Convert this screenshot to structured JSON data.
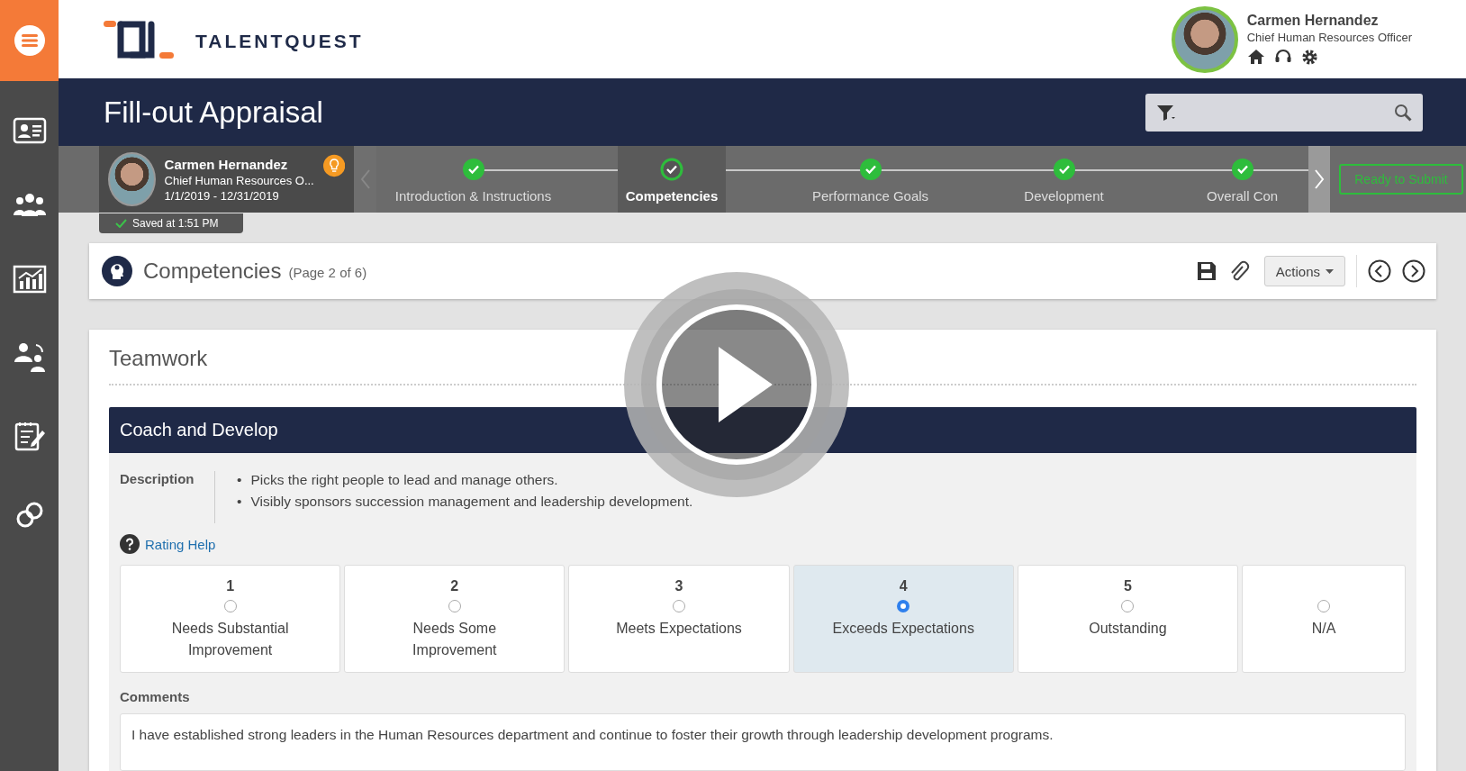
{
  "logo": {
    "text": "TALENTQUEST"
  },
  "user": {
    "name": "Carmen Hernandez",
    "role": "Chief Human Resources Officer"
  },
  "title": "Fill-out Appraisal",
  "employee": {
    "name": "Carmen Hernandez",
    "role": "Chief Human Resources O...",
    "period": "1/1/2019 - 12/31/2019",
    "saved": "Saved at 1:51 PM"
  },
  "steps": [
    {
      "label": "Introduction & Instructions",
      "done": true,
      "selected": false
    },
    {
      "label": "Competencies",
      "done": true,
      "selected": true
    },
    {
      "label": "Performance Goals",
      "done": true,
      "selected": false
    },
    {
      "label": "Development",
      "done": true,
      "selected": false
    },
    {
      "label": "Overall Con",
      "done": true,
      "selected": false
    }
  ],
  "submit_button": "Ready to Submit",
  "section": {
    "title": "Competencies",
    "page": "(Page 2 of 6)",
    "actions": "Actions"
  },
  "group": "Teamwork",
  "competency": {
    "title": "Coach and Develop",
    "description_label": "Description",
    "bullets": [
      {
        "marker": "•",
        "text": "Picks the right people to lead and manage others."
      },
      {
        "marker": "•",
        "text": "Visibly sponsors succession management and leadership development."
      }
    ]
  },
  "rating_help": "Rating Help",
  "ratings": [
    {
      "number": "1",
      "label": "Needs Substantial Improvement",
      "selected": false
    },
    {
      "number": "2",
      "label": "Needs Some Improvement",
      "selected": false
    },
    {
      "number": "3",
      "label": "Meets Expectations",
      "selected": false
    },
    {
      "number": "4",
      "label": "Exceeds Expectations",
      "selected": true
    },
    {
      "number": "5",
      "label": "Outstanding",
      "selected": false
    },
    {
      "label": "N/A",
      "selected": false
    }
  ],
  "comments": {
    "label": "Comments",
    "value": "I have established strong leaders in the Human Resources department and continue to foster their growth through leadership development programs."
  }
}
